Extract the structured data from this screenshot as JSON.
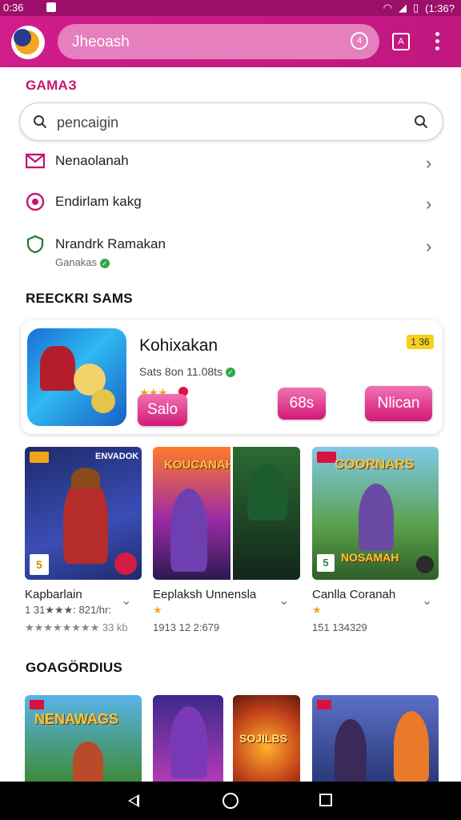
{
  "status_bar": {
    "time": "0:36",
    "right_text": "(1:36?"
  },
  "app_bar": {
    "search_text": "Jheoash",
    "search_icon_text": "4",
    "action_icon_text": "A"
  },
  "games_section": {
    "title": "GAMAЗ"
  },
  "search": {
    "value": "pencaigin"
  },
  "menu": [
    {
      "label": "Nenaolanah",
      "icon": "mail-icon"
    },
    {
      "label": "Endirlam kakg",
      "icon": "emblem-icon"
    },
    {
      "label": "Nrandrk Ramakan",
      "sub": "Ganakas",
      "icon": "shield-icon"
    }
  ],
  "recommended": {
    "title": "REECKRI SAMS",
    "featured": {
      "title": "Kohixakan",
      "meta": "Sats 8on 11.08ts",
      "badge": "1 36",
      "stars": "★★★",
      "buttons": [
        "Salo",
        "68s",
        "Nlican"
      ]
    },
    "tiles": [
      {
        "name": "Kapbarlain",
        "info": "1 31★★★: 821/hr:",
        "info2": "★★★★★★★★ 33 kb",
        "banner": "ENVADOK",
        "tag": "",
        "corner": "5"
      },
      {
        "name": "Eeplaksh Unnensla",
        "info": "★",
        "info2": "1913 12 2:679",
        "banner": "KOUCANAH",
        "tag": ""
      },
      {
        "name": "Canlla Coranah",
        "info": "★",
        "info2": "151 134329",
        "banner": "COORNARS",
        "tag": "",
        "sub_banner": "NOSAMAH",
        "corner": "5"
      }
    ]
  },
  "goago_section": {
    "title": "GOAGÖRDIUS",
    "tiles": [
      {
        "banner": "NENAWAGS"
      },
      {
        "banner": ""
      },
      {
        "banner": "SOJILBS"
      },
      {
        "banner": ""
      }
    ]
  },
  "colors": {
    "primary": "#c4166f",
    "app_bar": "#d11c8c",
    "status_bar": "#9c0f6a",
    "star": "#f2a81c",
    "badge": "#f6d01c"
  }
}
